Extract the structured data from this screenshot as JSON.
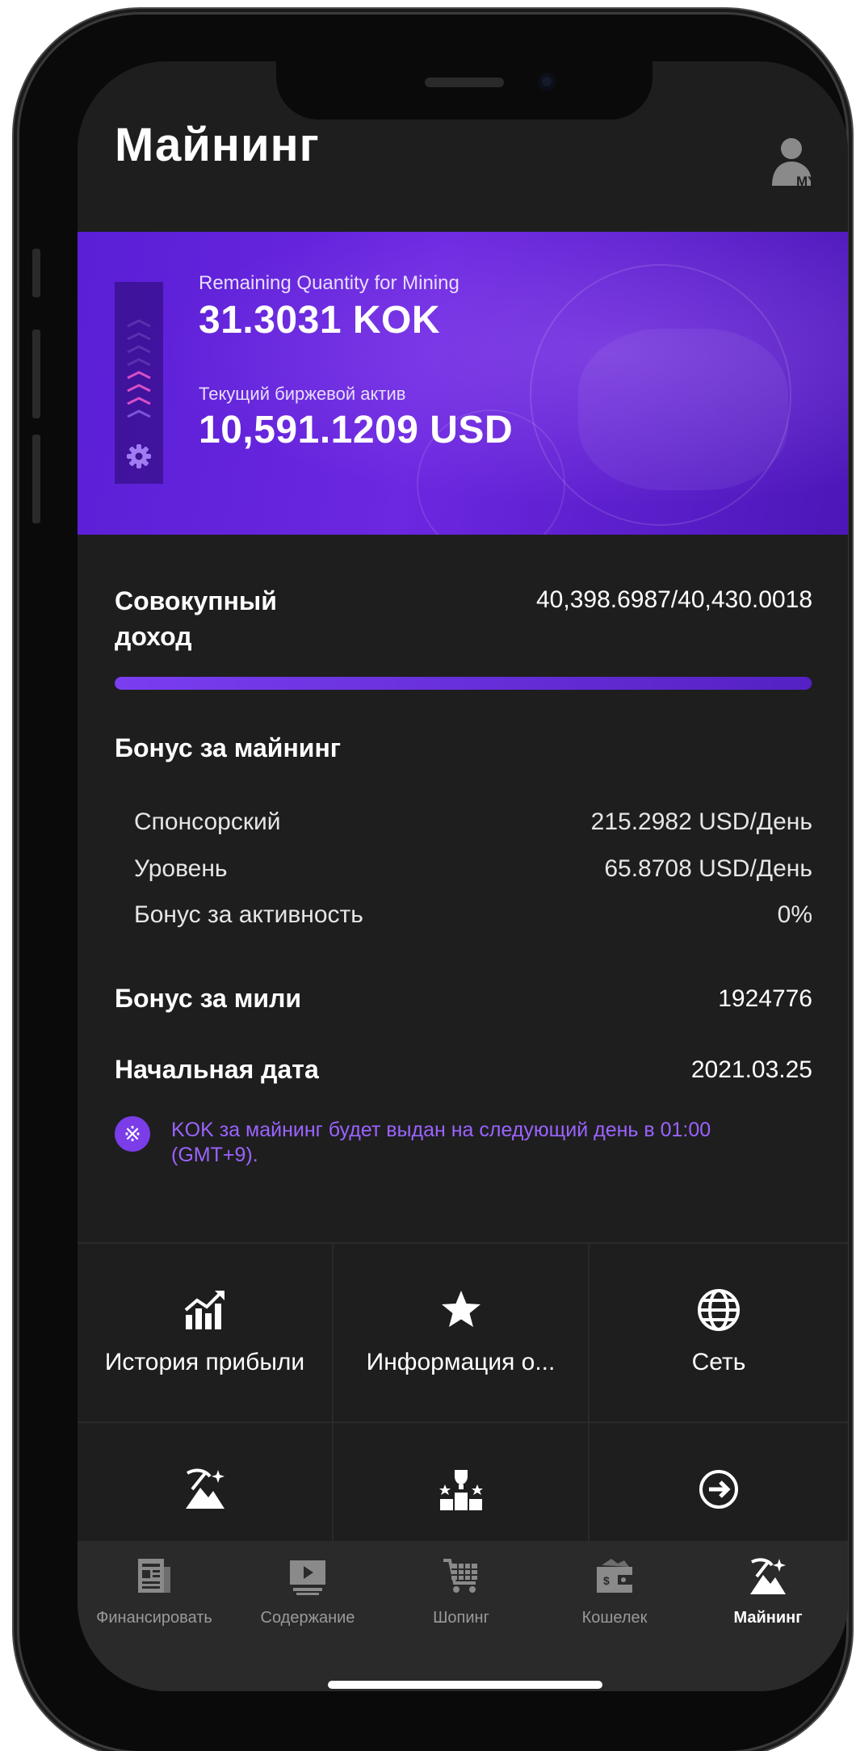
{
  "header": {
    "title": "Майнинг",
    "profile_badge": "MY"
  },
  "banner": {
    "remaining_label": "Remaining Quantity for Mining",
    "remaining_value": "31.3031 KOK",
    "asset_label": "Текущий биржевой актив",
    "asset_value": "10,591.1209 USD"
  },
  "income": {
    "label": "Совокупный доход",
    "value": "40,398.6987/40,430.0018",
    "progress_fraction": 0.9992
  },
  "mining_bonus": {
    "label": "Бонус за майнинг",
    "items": [
      {
        "label": "Спонсорский",
        "value": "215.2982 USD/День"
      },
      {
        "label": "Уровень",
        "value": "65.8708 USD/День"
      },
      {
        "label": "Бонус за активность",
        "value": "0%"
      }
    ]
  },
  "miles_bonus": {
    "label": "Бонус за мили",
    "value": "1924776"
  },
  "start_date": {
    "label": "Начальная дата",
    "value": "2021.03.25"
  },
  "notice": {
    "icon": "※",
    "text": "KOK за майнинг будет выдан на следующий день в 01:00 (GMT+9)."
  },
  "menu": [
    {
      "label": "История прибыли",
      "icon": "profit-chart-icon"
    },
    {
      "label": "Информация о...",
      "icon": "star-icon"
    },
    {
      "label": "Сеть",
      "icon": "globe-icon"
    },
    {
      "label": "",
      "icon": "mining-pick-icon"
    },
    {
      "label": "",
      "icon": "trophy-podium-icon"
    },
    {
      "label": "",
      "icon": "arrow-right-circle-icon"
    }
  ],
  "bottom_nav": [
    {
      "label": "Финансировать",
      "icon": "document-icon",
      "active": false
    },
    {
      "label": "Содержание",
      "icon": "video-play-icon",
      "active": false
    },
    {
      "label": "Шопинг",
      "icon": "cart-icon",
      "active": false
    },
    {
      "label": "Кошелек",
      "icon": "wallet-icon",
      "active": false
    },
    {
      "label": "Майнинг",
      "icon": "mining-icon",
      "active": true
    }
  ],
  "colors": {
    "accent": "#7a3de8",
    "notice_text": "#9b63ff",
    "banner": "#5a1fd6",
    "background": "#1e1e1e"
  }
}
